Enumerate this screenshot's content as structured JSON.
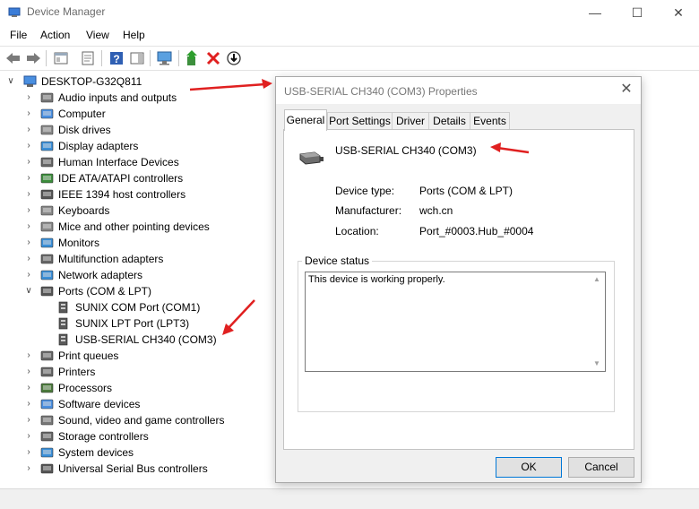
{
  "window": {
    "title": "Device Manager",
    "minimize": "—",
    "maximize": "☐",
    "close": "✕"
  },
  "menu": [
    "File",
    "Action",
    "View",
    "Help"
  ],
  "tree": {
    "root": "DESKTOP-G32Q811",
    "categories": [
      {
        "label": "Audio inputs and outputs",
        "icon": "speaker-icon"
      },
      {
        "label": "Computer",
        "icon": "computer-icon"
      },
      {
        "label": "Disk drives",
        "icon": "disk-icon"
      },
      {
        "label": "Display adapters",
        "icon": "display-icon"
      },
      {
        "label": "Human Interface Devices",
        "icon": "hid-icon"
      },
      {
        "label": "IDE ATA/ATAPI controllers",
        "icon": "ide-icon"
      },
      {
        "label": "IEEE 1394 host controllers",
        "icon": "ieee1394-icon"
      },
      {
        "label": "Keyboards",
        "icon": "keyboard-icon"
      },
      {
        "label": "Mice and other pointing devices",
        "icon": "mouse-icon"
      },
      {
        "label": "Monitors",
        "icon": "monitor-icon"
      },
      {
        "label": "Multifunction adapters",
        "icon": "multifunction-icon"
      },
      {
        "label": "Network adapters",
        "icon": "network-icon"
      },
      {
        "label": "Ports (COM & LPT)",
        "icon": "port-icon",
        "expanded": true,
        "children": [
          {
            "label": "SUNIX COM Port (COM1)",
            "icon": "port-device-icon"
          },
          {
            "label": "SUNIX LPT Port (LPT3)",
            "icon": "port-device-icon"
          },
          {
            "label": "USB-SERIAL CH340 (COM3)",
            "icon": "port-device-icon"
          }
        ]
      },
      {
        "label": "Print queues",
        "icon": "print-queue-icon"
      },
      {
        "label": "Printers",
        "icon": "printer-icon"
      },
      {
        "label": "Processors",
        "icon": "processor-icon"
      },
      {
        "label": "Software devices",
        "icon": "software-device-icon"
      },
      {
        "label": "Sound, video and game controllers",
        "icon": "sound-icon"
      },
      {
        "label": "Storage controllers",
        "icon": "storage-icon"
      },
      {
        "label": "System devices",
        "icon": "system-device-icon"
      },
      {
        "label": "Universal Serial Bus controllers",
        "icon": "usb-icon"
      }
    ]
  },
  "dialog": {
    "title": "USB-SERIAL CH340 (COM3) Properties",
    "tabs": [
      "General",
      "Port Settings",
      "Driver",
      "Details",
      "Events"
    ],
    "active_tab": "General",
    "device_name": "USB-SERIAL CH340 (COM3)",
    "fields": [
      {
        "label": "Device type:",
        "value": "Ports (COM & LPT)"
      },
      {
        "label": "Manufacturer:",
        "value": "wch.cn"
      },
      {
        "label": "Location:",
        "value": "Port_#0003.Hub_#0004"
      }
    ],
    "status_group_label": "Device status",
    "status_text": "This device is working properly.",
    "ok_label": "OK",
    "cancel_label": "Cancel"
  },
  "colors": {
    "annotation_arrow": "#e02020",
    "accent": "#0078d7"
  }
}
